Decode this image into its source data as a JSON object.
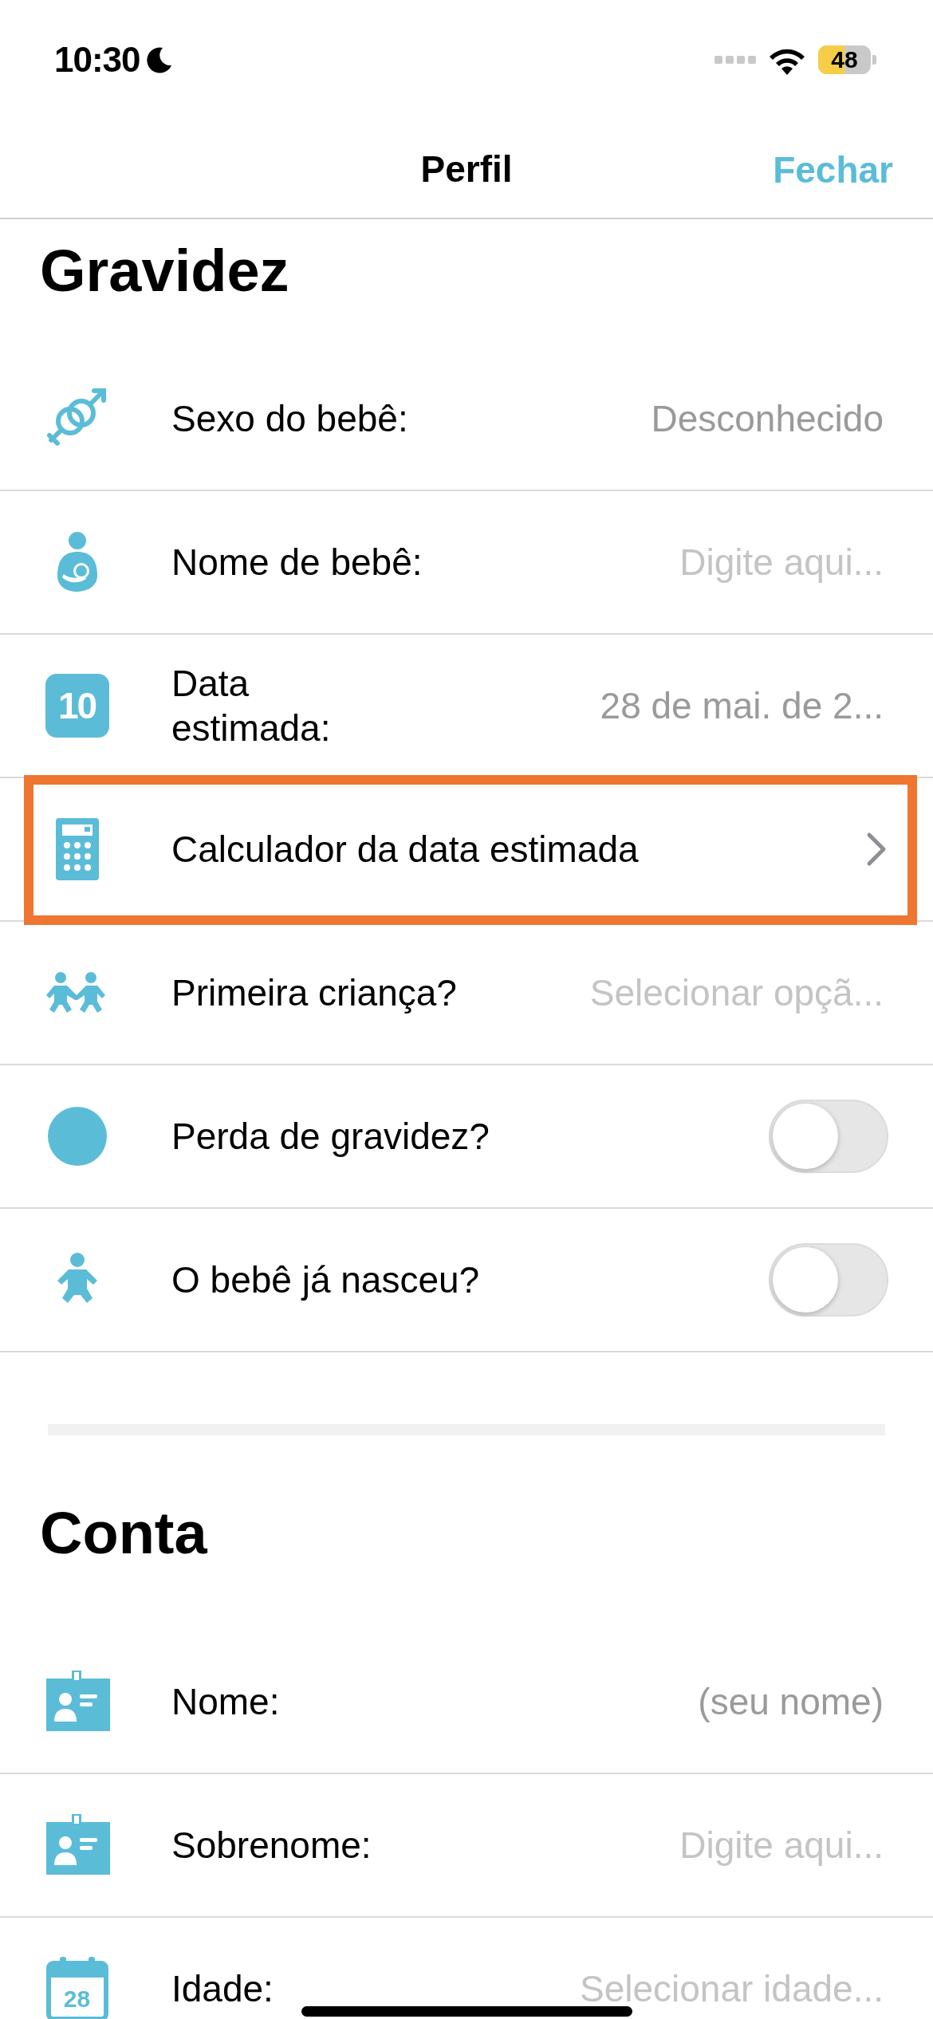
{
  "status_bar": {
    "time": "10:30",
    "battery": "48"
  },
  "nav": {
    "title": "Perfil",
    "close": "Fechar"
  },
  "sections": [
    {
      "title": "Gravidez",
      "rows": [
        {
          "kind": "value",
          "label": "Sexo do bebê:",
          "value": "Desconhecido"
        },
        {
          "kind": "value",
          "label": "Nome de bebê:",
          "placeholder": "Digite aqui..."
        },
        {
          "kind": "value",
          "label": "Data\nestimada:",
          "value": "28 de mai. de 2...",
          "icon_text": "10"
        },
        {
          "kind": "link",
          "label": "Calculador da data estimada",
          "highlighted": true
        },
        {
          "kind": "value",
          "label": "Primeira criança?",
          "placeholder": "Selecionar opçã..."
        },
        {
          "kind": "toggle",
          "label": "Perda de gravidez?",
          "on": false
        },
        {
          "kind": "toggle",
          "label": "O bebê já nasceu?",
          "on": false
        }
      ]
    },
    {
      "title": "Conta",
      "rows": [
        {
          "kind": "value",
          "label": "Nome:",
          "value": "(seu nome)"
        },
        {
          "kind": "value",
          "label": "Sobrenome:",
          "placeholder": "Digite aqui..."
        },
        {
          "kind": "value",
          "label": "Idade:",
          "placeholder": "Selecionar idade...",
          "icon_text": "28"
        }
      ]
    }
  ]
}
